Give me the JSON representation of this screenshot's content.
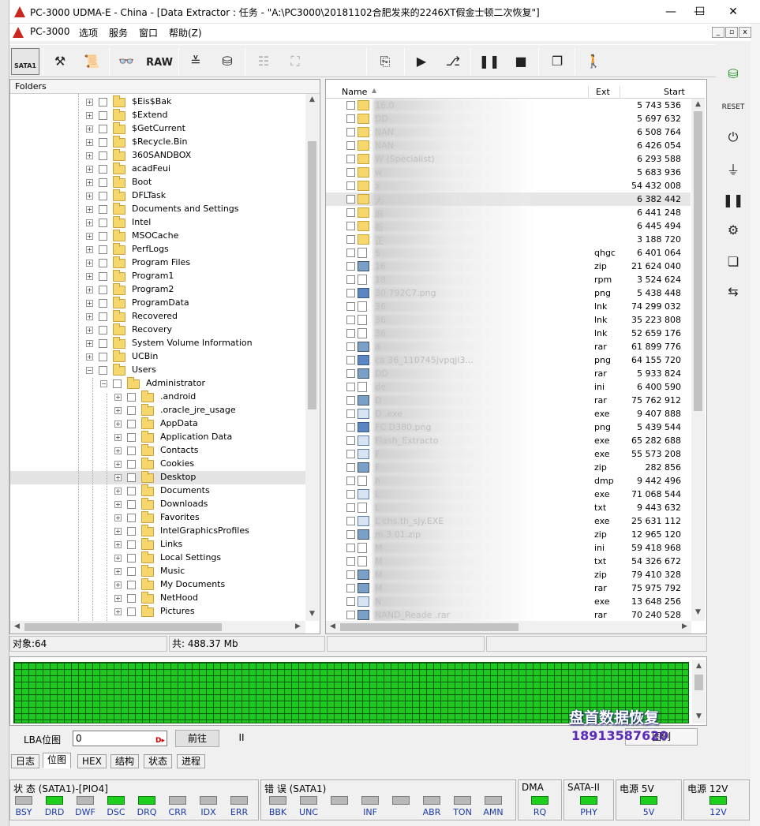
{
  "window": {
    "title": "PC-3000 UDMA-E - China - [Data Extractor : 任务 - \"A:\\PC3000\\20181102合肥发来的2246XT假金士顿二次恢复\"]",
    "minimize": "—",
    "maximize": "☐",
    "close": "✕"
  },
  "menu": {
    "items": [
      "PC-3000",
      "选项",
      "服务",
      "窗口",
      "帮助(Z)"
    ],
    "mdi": [
      "_",
      "▫",
      "x"
    ]
  },
  "toolbar": {
    "sata_label": "SATA1",
    "raw_label": "RAW"
  },
  "folders": {
    "header": "Folders",
    "items": [
      {
        "label": "$Eis$Bak",
        "level": 0,
        "exp": "+"
      },
      {
        "label": "$Extend",
        "level": 0,
        "exp": "+"
      },
      {
        "label": "$GetCurrent",
        "level": 0,
        "exp": "+"
      },
      {
        "label": "$Recycle.Bin",
        "level": 0,
        "exp": "+"
      },
      {
        "label": "360SANDBOX",
        "level": 0,
        "exp": "+"
      },
      {
        "label": "acadFeui",
        "level": 0,
        "exp": "+"
      },
      {
        "label": "Boot",
        "level": 0,
        "exp": "+"
      },
      {
        "label": "DFLTask",
        "level": 0,
        "exp": "+"
      },
      {
        "label": "Documents and Settings",
        "level": 0,
        "exp": "+"
      },
      {
        "label": "Intel",
        "level": 0,
        "exp": "+"
      },
      {
        "label": "MSOCache",
        "level": 0,
        "exp": "+"
      },
      {
        "label": "PerfLogs",
        "level": 0,
        "exp": "+"
      },
      {
        "label": "Program Files",
        "level": 0,
        "exp": "+"
      },
      {
        "label": "Program1",
        "level": 0,
        "exp": "+"
      },
      {
        "label": "Program2",
        "level": 0,
        "exp": "+"
      },
      {
        "label": "ProgramData",
        "level": 0,
        "exp": "+"
      },
      {
        "label": "Recovered",
        "level": 0,
        "exp": "+"
      },
      {
        "label": "Recovery",
        "level": 0,
        "exp": "+"
      },
      {
        "label": "System Volume Information",
        "level": 0,
        "exp": "+"
      },
      {
        "label": "UCBin",
        "level": 0,
        "exp": "+"
      },
      {
        "label": "Users",
        "level": 0,
        "exp": "−"
      },
      {
        "label": "Administrator",
        "level": 1,
        "exp": "−"
      },
      {
        "label": ".android",
        "level": 2,
        "exp": "+"
      },
      {
        "label": ".oracle_jre_usage",
        "level": 2,
        "exp": "+"
      },
      {
        "label": "AppData",
        "level": 2,
        "exp": "+"
      },
      {
        "label": "Application Data",
        "level": 2,
        "exp": "+"
      },
      {
        "label": "Contacts",
        "level": 2,
        "exp": "+"
      },
      {
        "label": "Cookies",
        "level": 2,
        "exp": "+"
      },
      {
        "label": "Desktop",
        "level": 2,
        "exp": "+",
        "selected": true
      },
      {
        "label": "Documents",
        "level": 2,
        "exp": "+"
      },
      {
        "label": "Downloads",
        "level": 2,
        "exp": "+"
      },
      {
        "label": "Favorites",
        "level": 2,
        "exp": "+"
      },
      {
        "label": "IntelGraphicsProfiles",
        "level": 2,
        "exp": "+"
      },
      {
        "label": "Links",
        "level": 2,
        "exp": "+"
      },
      {
        "label": "Local Settings",
        "level": 2,
        "exp": "+"
      },
      {
        "label": "Music",
        "level": 2,
        "exp": "+"
      },
      {
        "label": "My Documents",
        "level": 2,
        "exp": "+"
      },
      {
        "label": "NetHood",
        "level": 2,
        "exp": "+"
      },
      {
        "label": "Pictures",
        "level": 2,
        "exp": "+"
      }
    ]
  },
  "files": {
    "columns": {
      "name": "Name",
      "ext": "Ext",
      "start": "Start"
    },
    "rows": [
      {
        "name": "16.0",
        "ext": "",
        "start": "5 743 536",
        "icon": "folder"
      },
      {
        "name": "DD",
        "ext": "",
        "start": "5 697 632",
        "icon": "folder"
      },
      {
        "name": "NAN",
        "ext": "",
        "start": "6 508 764",
        "icon": "folder"
      },
      {
        "name": "NAN",
        "ext": "",
        "start": "6 426 054",
        "icon": "folder"
      },
      {
        "name": "W                                  (Specialist)",
        "ext": "",
        "start": "6 293 588",
        "icon": "folder"
      },
      {
        "name": "w",
        "ext": "",
        "start": "5 683 936",
        "icon": "folder"
      },
      {
        "name": "x",
        "ext": "",
        "start": "54 432 008",
        "icon": "folder"
      },
      {
        "name": "大",
        "ext": "",
        "start": "6 382 442",
        "icon": "folder",
        "selected": true
      },
      {
        "name": "麻",
        "ext": "",
        "start": "6 441 248",
        "icon": "folder"
      },
      {
        "name": "新",
        "ext": "",
        "start": "6 445 494",
        "icon": "folder"
      },
      {
        "name": "正",
        "ext": "",
        "start": "3 188 720",
        "icon": "folder"
      },
      {
        "name": "$",
        "ext": "qhgc",
        "start": "6 401 064",
        "icon": "file"
      },
      {
        "name": "16",
        "ext": "zip",
        "start": "21 624 040",
        "icon": "arch"
      },
      {
        "name": "18",
        "ext": "rpm",
        "start": "3 524 624",
        "icon": "file"
      },
      {
        "name": "30                                  792C7.png",
        "ext": "png",
        "start": "5 438 448",
        "icon": "img"
      },
      {
        "name": "36",
        "ext": "lnk",
        "start": "74 299 032",
        "icon": "file"
      },
      {
        "name": "36",
        "ext": "lnk",
        "start": "35 223 808",
        "icon": "file"
      },
      {
        "name": "36",
        "ext": "lnk",
        "start": "52 659 176",
        "icon": "file"
      },
      {
        "name": "a",
        "ext": "rar",
        "start": "61 899 776",
        "icon": "arch"
      },
      {
        "name": "ca                           36_110745jvpqji3...",
        "ext": "png",
        "start": "64 155 720",
        "icon": "img"
      },
      {
        "name": "DD",
        "ext": "rar",
        "start": "5 933 824",
        "icon": "arch"
      },
      {
        "name": "de",
        "ext": "ini",
        "start": "6 400 590",
        "icon": "file"
      },
      {
        "name": "D",
        "ext": "rar",
        "start": "75 762 912",
        "icon": "arch"
      },
      {
        "name": "D                                    .exe",
        "ext": "exe",
        "start": "9 407 888",
        "icon": "exe"
      },
      {
        "name": "FC                                 D380.png",
        "ext": "png",
        "start": "5 439 544",
        "icon": "img"
      },
      {
        "name": "Flash_Extracto",
        "ext": "exe",
        "start": "65 282 688",
        "icon": "exe"
      },
      {
        "name": "F",
        "ext": "exe",
        "start": "55 573 208",
        "icon": "exe"
      },
      {
        "name": "F",
        "ext": "zip",
        "start": "282 856",
        "icon": "arch"
      },
      {
        "name": "h",
        "ext": "dmp",
        "start": "9 442 496",
        "icon": "file"
      },
      {
        "name": "L",
        "ext": "exe",
        "start": "71 068 544",
        "icon": "exe"
      },
      {
        "name": "L",
        "ext": "txt",
        "start": "9 443 632",
        "icon": "file"
      },
      {
        "name": "L                                 chs.th_sjy.EXE",
        "ext": "exe",
        "start": "25 631 112",
        "icon": "exe"
      },
      {
        "name": "m                                 3.01.zip",
        "ext": "zip",
        "start": "12 965 120",
        "icon": "arch"
      },
      {
        "name": "M",
        "ext": "ini",
        "start": "59 418 968",
        "icon": "file"
      },
      {
        "name": "M",
        "ext": "txt",
        "start": "54 326 672",
        "icon": "file"
      },
      {
        "name": "M",
        "ext": "zip",
        "start": "79 410 328",
        "icon": "arch"
      },
      {
        "name": "M",
        "ext": "rar",
        "start": "75 975 792",
        "icon": "arch"
      },
      {
        "name": "N",
        "ext": "exe",
        "start": "13 648 256",
        "icon": "exe"
      },
      {
        "name": "NAND_Reade          .rar",
        "ext": "rar",
        "start": "70 240 528",
        "icon": "arch"
      }
    ]
  },
  "statusbar": {
    "objects": "对象:64",
    "total": "共: 488.37 Mb"
  },
  "map": {
    "watermark": "盘首数据恢复",
    "phone": "18913587620"
  },
  "lba": {
    "label": "LBA位图",
    "value": "0",
    "go_button": "前往",
    "pause": "II",
    "right_button": "图例"
  },
  "tabs": [
    "日志",
    "位图",
    "HEX",
    "结构",
    "状态",
    "进程"
  ],
  "indicators": {
    "status_title": "状 态 (SATA1)-[PIO4]",
    "status_leds": [
      {
        "label": "BSY",
        "on": false
      },
      {
        "label": "DRD",
        "on": true
      },
      {
        "label": "DWF",
        "on": false
      },
      {
        "label": "DSC",
        "on": true
      },
      {
        "label": "DRQ",
        "on": true
      },
      {
        "label": "CRR",
        "on": false
      },
      {
        "label": "IDX",
        "on": false
      },
      {
        "label": "ERR",
        "on": false
      }
    ],
    "error_title": "错 误 (SATA1)",
    "error_leds": [
      {
        "label": "BBK",
        "on": false
      },
      {
        "label": "UNC",
        "on": false
      },
      {
        "label": "",
        "on": false
      },
      {
        "label": "INF",
        "on": false
      },
      {
        "label": "",
        "on": false
      },
      {
        "label": "ABR",
        "on": false
      },
      {
        "label": "TON",
        "on": false
      },
      {
        "label": "AMN",
        "on": false
      }
    ],
    "dma_title": "DMA",
    "dma_led": "RQ",
    "sata_title": "SATA-II",
    "sata_led": "PHY",
    "p5_title": "电源 5V",
    "p5_led": "5V",
    "p12_title": "电源 12V",
    "p12_led": "12V"
  }
}
